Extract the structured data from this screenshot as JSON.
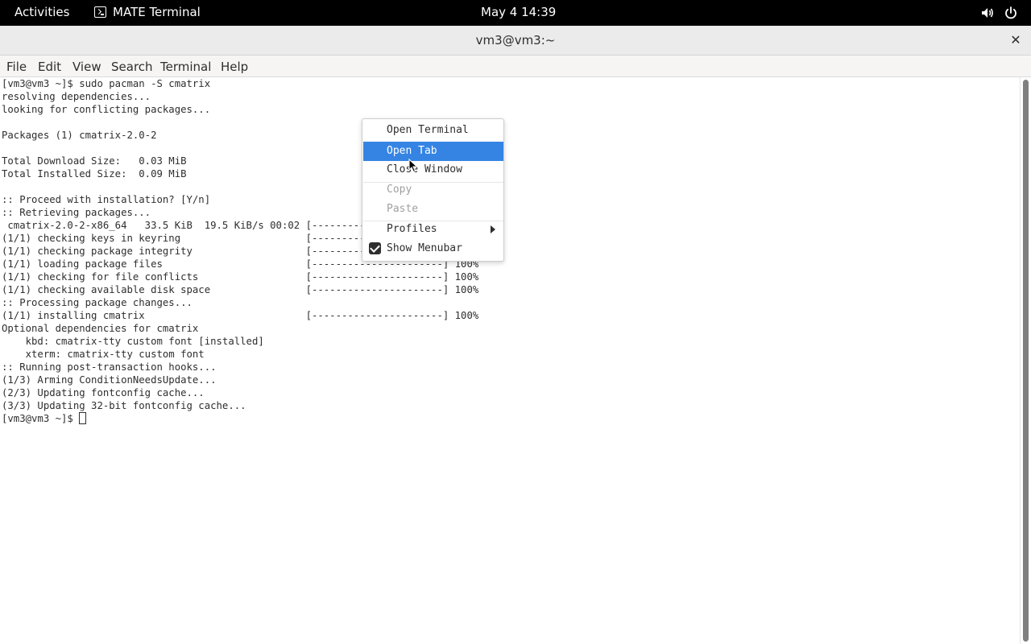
{
  "topbar": {
    "activities": "Activities",
    "app_name": "MATE Terminal",
    "clock": "May 4  14:39",
    "icons": {
      "app": "terminal-icon",
      "volume": "volume-icon",
      "power": "power-icon"
    }
  },
  "window": {
    "title": "vm3@vm3:~",
    "close_glyph": "✕"
  },
  "menubar": [
    "File",
    "Edit",
    "View",
    "Search",
    "Terminal",
    "Help"
  ],
  "terminal": {
    "lines": [
      "[vm3@vm3 ~]$ sudo pacman -S cmatrix",
      "resolving dependencies...",
      "looking for conflicting packages...",
      "",
      "Packages (1) cmatrix-2.0-2",
      "",
      "Total Download Size:   0.03 MiB",
      "Total Installed Size:  0.09 MiB",
      "",
      ":: Proceed with installation? [Y/n]",
      ":: Retrieving packages...",
      " cmatrix-2.0-2-x86_64   33.5 KiB  19.5 KiB/s 00:02 [----------------------] 100%",
      "(1/1) checking keys in keyring                     [----------------------] 100%",
      "(1/1) checking package integrity                   [----------------------] 100%",
      "(1/1) loading package files                        [----------------------] 100%",
      "(1/1) checking for file conflicts                  [----------------------] 100%",
      "(1/1) checking available disk space                [----------------------] 100%",
      ":: Processing package changes...",
      "(1/1) installing cmatrix                           [----------------------] 100%",
      "Optional dependencies for cmatrix",
      "    kbd: cmatrix-tty custom font [installed]",
      "    xterm: cmatrix-tty custom font",
      ":: Running post-transaction hooks...",
      "(1/3) Arming ConditionNeedsUpdate...",
      "(2/3) Updating fontconfig cache...",
      "(3/3) Updating 32-bit fontconfig cache..."
    ],
    "prompt": "[vm3@vm3 ~]$ "
  },
  "context_menu": {
    "open_terminal": "Open Terminal",
    "open_tab": "Open Tab",
    "close_window": "Close Window",
    "copy": "Copy",
    "paste": "Paste",
    "profiles": "Profiles",
    "show_menubar": "Show Menubar",
    "show_menubar_checked": true,
    "selected_item": "Open Tab"
  },
  "colors": {
    "accent": "#3584e4",
    "topbar_bg": "#000000",
    "text": "#2e2e2e"
  }
}
